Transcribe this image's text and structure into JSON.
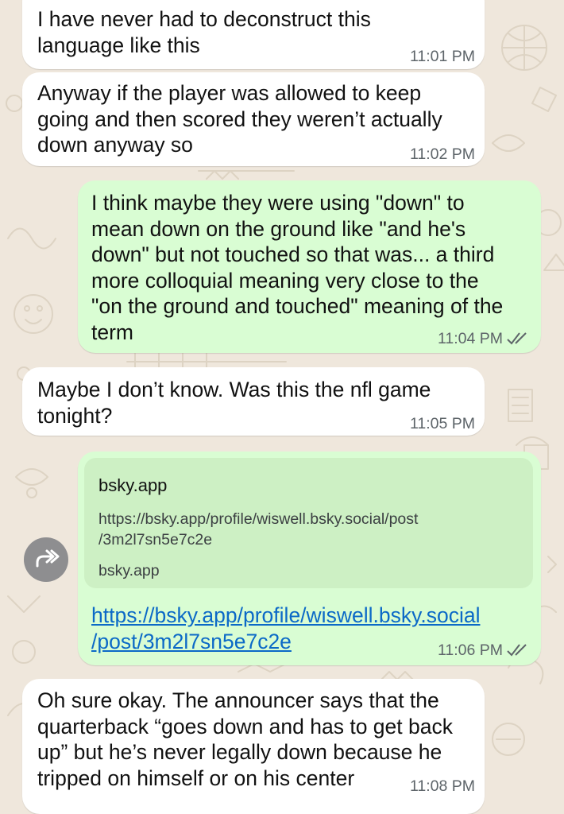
{
  "messages": [
    {
      "direction": "incoming",
      "lines": [
        "I have never had to deconstruct this",
        "language like this"
      ],
      "time": "11:01 PM"
    },
    {
      "direction": "incoming",
      "lines": [
        "Anyway if the player was allowed to keep",
        "going and then scored they weren’t actually",
        "down anyway so"
      ],
      "time": "11:02 PM"
    },
    {
      "direction": "outgoing",
      "lines": [
        "I think maybe they were using \"down\" to",
        "mean down on the ground like \"and he's",
        "down\" but not touched so that was... a third",
        "more colloquial meaning very close to the",
        "\"on the ground and touched\" meaning of the",
        "term"
      ],
      "time": "11:04 PM",
      "status_icon": "double-check-read"
    },
    {
      "direction": "incoming",
      "lines": [
        "Maybe I don’t know. Was this the nfl game",
        "tonight?"
      ],
      "time": "11:05 PM"
    },
    {
      "direction": "outgoing",
      "link_preview": {
        "title": "bsky.app",
        "url_lines": [
          "https://bsky.app/profile/wiswell.bsky.social/post",
          "/3m2l7sn5e7c2e"
        ],
        "domain": "bsky.app"
      },
      "link_lines": [
        "https://bsky.app/profile/wiswell.bsky.social",
        "/post/3m2l7sn5e7c2e"
      ],
      "time": "11:06 PM",
      "status_icon": "double-check-read"
    },
    {
      "direction": "incoming",
      "lines": [
        "Oh sure okay. The announcer says that the",
        "quarterback “goes down and has to get back",
        "up” but he’s never legally down because he",
        "tripped on himself or on his center"
      ],
      "time": "11:08 PM"
    }
  ],
  "forward_button": {
    "icon": "forward-icon"
  },
  "colors": {
    "incoming_bubble": "#ffffff",
    "outgoing_bubble": "#d9fdd3",
    "link_preview_bg": "#cdf0c4",
    "link": "#0b69c7",
    "wallpaper": "#efe7dc",
    "timestamp": "#5d6469"
  }
}
